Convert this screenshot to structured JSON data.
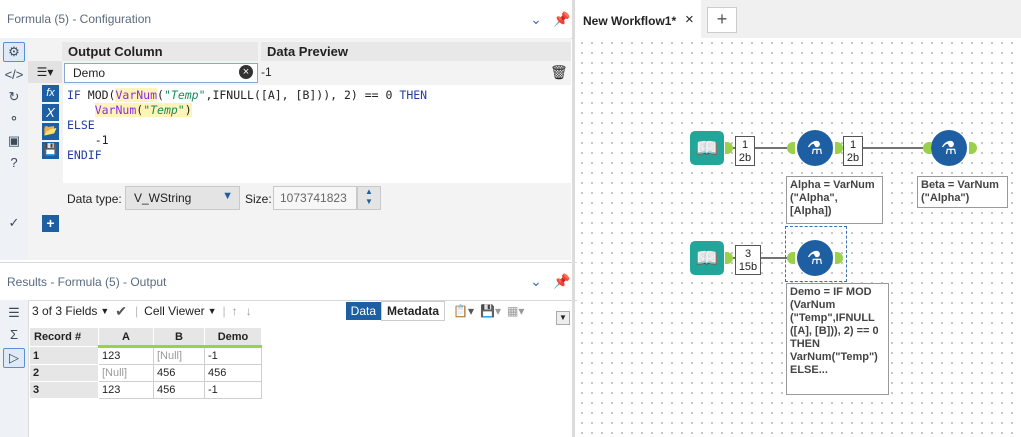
{
  "config_panel": {
    "title": "Formula (5) - Configuration",
    "columns": {
      "output": "Output Column",
      "preview": "Data Preview"
    },
    "row": {
      "output_value": "Demo",
      "preview_value": "-1"
    },
    "expression_lines": [
      "IF MOD(VarNum(\"Temp\",IFNULL([A], [B])), 2) == 0 THEN",
      "    VarNum(\"Temp\")",
      "ELSE",
      "    -1",
      "ENDIF"
    ],
    "data_type_label": "Data type:",
    "data_type_value": "V_WString",
    "size_label": "Size:",
    "size_value": "1073741823"
  },
  "results_panel": {
    "title": "Results - Formula (5) - Output",
    "fields_text": "3 of 3 Fields",
    "cell_viewer": "Cell Viewer",
    "tab_data": "Data",
    "tab_metadata": "Metadata",
    "headers": [
      "Record #",
      "A",
      "B",
      "Demo"
    ],
    "rows": [
      [
        "1",
        "123",
        "[Null]",
        "-1"
      ],
      [
        "2",
        "[Null]",
        "456",
        "456"
      ],
      [
        "3",
        "123",
        "456",
        "-1"
      ]
    ]
  },
  "workflow": {
    "tab_title": "New Workflow1*",
    "close_icon_text": "×",
    "add_tab_text": "+",
    "counts": [
      {
        "top": "1",
        "bottom": "2b"
      },
      {
        "top": "1",
        "bottom": "2b"
      },
      {
        "top": "3",
        "bottom": "15b"
      }
    ],
    "annotations": {
      "alpha": "Alpha = VarNum (\"Alpha\", [Alpha])",
      "beta": "Beta = VarNum (\"Alpha\")",
      "demo": "Demo = IF MOD (VarNum (\"Temp\",IFNULL ([A], [B])), 2) == 0 THEN VarNum(\"Temp\") ELSE..."
    }
  },
  "colors": {
    "accent": "#1e5fa4",
    "input_tool": "#22a69a",
    "anchor": "#9bd14a"
  }
}
